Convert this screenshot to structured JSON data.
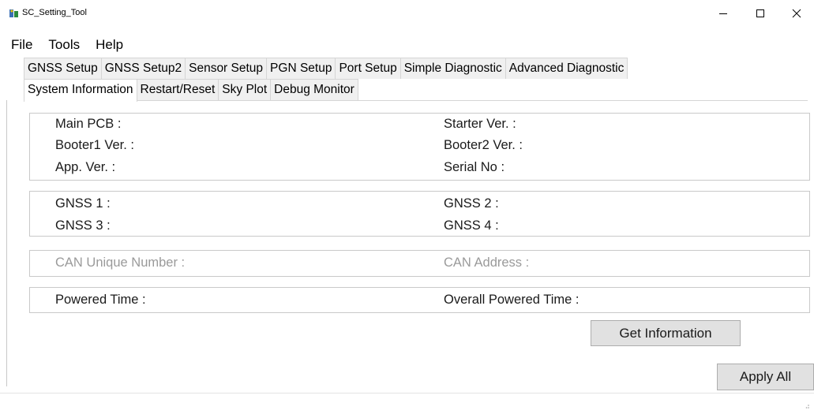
{
  "window": {
    "title": "SC_Setting_Tool",
    "icon": "app-icon",
    "controls": [
      "minimize",
      "maximize",
      "close"
    ]
  },
  "menu": {
    "items": [
      "File",
      "Tools",
      "Help"
    ]
  },
  "tabs_row1": [
    "GNSS Setup",
    "GNSS Setup2",
    "Sensor Setup",
    "PGN Setup",
    "Port Setup",
    "Simple Diagnostic",
    "Advanced Diagnostic"
  ],
  "tabs_row2": [
    "System Information",
    "Restart/Reset",
    "Sky Plot",
    "Debug Monitor"
  ],
  "active_tab": "System Information",
  "system_info": {
    "main_pcb": "Main PCB :",
    "starter_ver": "Starter Ver. :",
    "booter1_ver": "Booter1 Ver. :",
    "booter2_ver": "Booter2 Ver. :",
    "app_ver": "App. Ver. :",
    "serial_no": "Serial No :"
  },
  "gnss": {
    "gnss1": "GNSS 1 :",
    "gnss2": "GNSS 2 :",
    "gnss3": "GNSS 3 :",
    "gnss4": "GNSS 4 :"
  },
  "can": {
    "unique_number": "CAN Unique Number :",
    "address": "CAN Address :"
  },
  "power": {
    "powered_time": "Powered Time :",
    "overall_powered_time": "Overall Powered Time :"
  },
  "buttons": {
    "get_information": "Get Information",
    "apply_all": "Apply All"
  },
  "colors": {
    "tab_bg": "#f0f0f0",
    "border": "#c9c9c9",
    "disabled_text": "#9a9a9a",
    "button_bg": "#e1e1e1"
  }
}
